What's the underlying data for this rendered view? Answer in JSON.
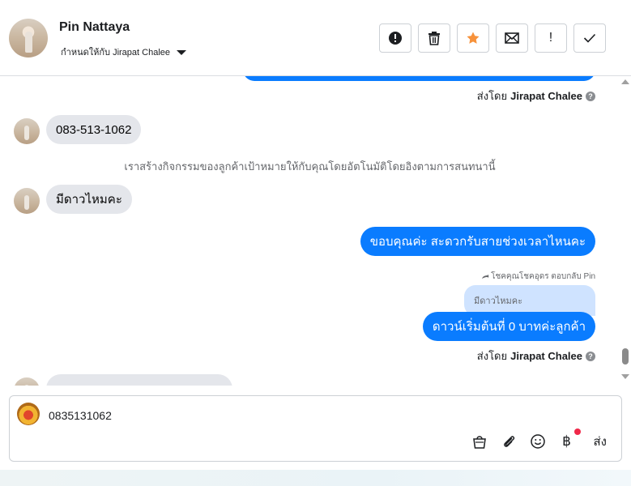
{
  "header": {
    "contact_name": "Pin Nattaya",
    "assigned_to": "กำหนดให้กับ Jirapat Chalee",
    "actions": [
      {
        "name": "report",
        "label": ""
      },
      {
        "name": "delete",
        "label": ""
      },
      {
        "name": "star",
        "label": ""
      },
      {
        "name": "mark-unread",
        "label": ""
      },
      {
        "name": "follow-up",
        "label": "!"
      },
      {
        "name": "mark-done",
        "label": ""
      }
    ],
    "accent_star": "#f7923b"
  },
  "chat": {
    "sent_by_prefix": "ส่งโดย",
    "sent_by_name": "Jirapat Chalee",
    "messages": {
      "incoming_phone": "083-513-1062",
      "system_note": "เราสร้างกิจกรรมของลูกค้าเป้าหมายให้กับคุณโดยอัตโนมัติโดยอิงตามการสนทนานี้",
      "incoming_question": "มีดาวไหมคะ",
      "outgoing_thanks": "ขอบคุณค่ะ สะดวกรับสายช่วงเวลาไหนคะ",
      "reply_meta": "โชคคุณโชคอุดร ตอบกลับ Pin",
      "quoted_text": "มีดาวไหมคะ",
      "outgoing_answer": "ดาวน์เริ่มต้นที่ 0 บาทค่ะลูกค้า"
    },
    "outgoing_color": "#0a7cff",
    "incoming_color": "#e4e6eb"
  },
  "composer": {
    "value": "0835131062",
    "send_label": "ส่ง",
    "icons": [
      "bag-icon",
      "paperclip-icon",
      "emoji-icon",
      "baht-icon"
    ]
  }
}
